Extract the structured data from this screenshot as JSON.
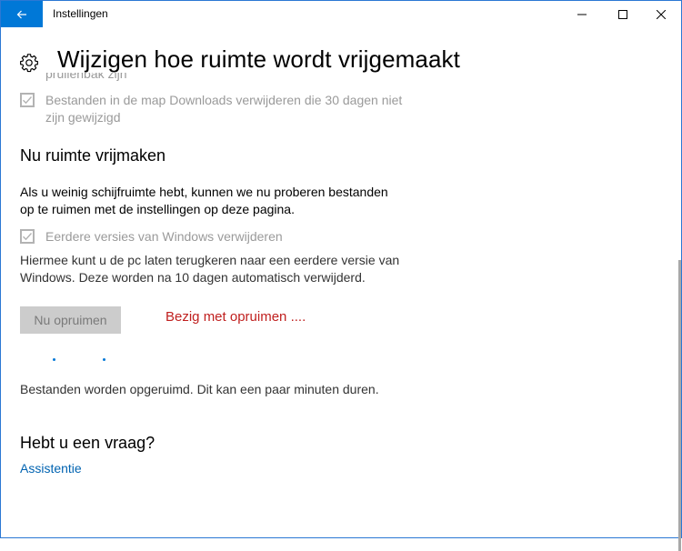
{
  "window": {
    "title": "Instellingen",
    "back_icon": "back-arrow-icon",
    "minimize_icon": "minimize-icon",
    "maximize_icon": "maximize-icon",
    "close_icon": "close-icon",
    "accent": "#0078d7"
  },
  "page": {
    "title": "Wijzigen hoe ruimte wordt vrijgemaakt",
    "title_icon": "gear-icon"
  },
  "downloads_option": {
    "clipped_text": "prullenbak zijn",
    "label_line1": "Bestanden in de map Downloads verwijderen die 30 dagen niet",
    "label_line2": "zijn gewijzigd",
    "checked": true
  },
  "free_space": {
    "heading": "Nu ruimte vrijmaken",
    "intro_line1": "Als u weinig schijfruimte hebt, kunnen we nu proberen bestanden",
    "intro_line2": "op te ruimen met de instellingen op deze pagina.",
    "previous_windows_label": "Eerdere versies van Windows verwijderen",
    "previous_windows_checked": true,
    "description_line1": "Hiermee kunt u de pc laten terugkeren naar een eerdere versie van",
    "description_line2": "Windows. Deze worden na 10 dagen automatisch verwijderd.",
    "cleanup_button": "Nu opruimen",
    "busy_text": "Bezig met opruimen ....",
    "busy_color": "#c0201f",
    "progress_status": "Bestanden worden opgeruimd. Dit kan een paar minuten duren."
  },
  "help": {
    "heading": "Hebt u een vraag?",
    "link": "Assistentie",
    "link_color": "#0063b1"
  }
}
